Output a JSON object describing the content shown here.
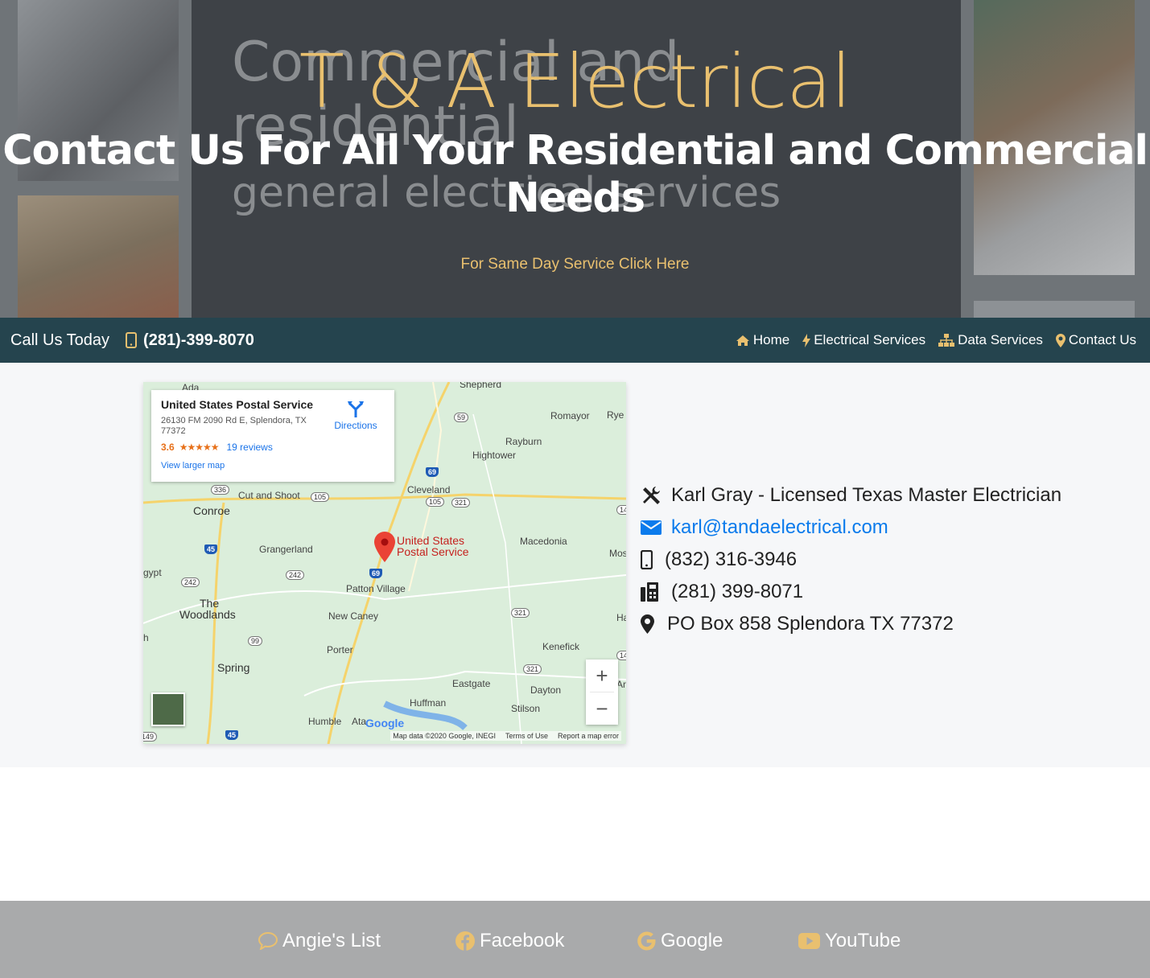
{
  "hero": {
    "bg_text_1": "Commercial and",
    "bg_text_2": "residential",
    "bg_text_3": "general electrical services",
    "title": "T & A Electrical",
    "subtitle": "Contact Us For All Your Residential and Commercial Needs",
    "cta": "For Same Day Service Click Here"
  },
  "nav": {
    "call_label": "Call Us Today",
    "phone": "(281)-399-8070",
    "links": [
      {
        "label": "Home",
        "icon": "home-icon"
      },
      {
        "label": "Electrical Services",
        "icon": "bolt-icon"
      },
      {
        "label": "Data Services",
        "icon": "network-icon"
      },
      {
        "label": "Contact Us",
        "icon": "map-marker-icon"
      }
    ]
  },
  "map": {
    "place_name": "United States Postal Service",
    "address": "26130 FM 2090 Rd E, Splendora, TX 77372",
    "rating": "3.6",
    "stars": "★★★★★",
    "reviews": "19 reviews",
    "larger_map": "View larger map",
    "directions": "Directions",
    "pin_label_1": "United States",
    "pin_label_2": "Postal Service",
    "zoom_in": "+",
    "zoom_out": "−",
    "google": "Google",
    "footer_data": "Map data ©2020 Google, INEGI",
    "footer_terms": "Terms of Use",
    "footer_report": "Report a map error",
    "labels": {
      "shepherd": "Shepherd",
      "romayor": "Romayor",
      "rye": "Rye",
      "rayburn": "Rayburn",
      "hightower": "Hightower",
      "cleveland": "Cleveland",
      "cut_and_shoot": "Cut and Shoot",
      "conroe": "Conroe",
      "grangerland": "Grangerland",
      "macedonia": "Macedonia",
      "mos": "Mos",
      "patton_village": "Patton Village",
      "gypt": "gypt",
      "the_woodlands_1": "The",
      "the_woodlands_2": "Woodlands",
      "new_caney": "New Caney",
      "ha": "Ha",
      "porter": "Porter",
      "kenefick": "Kenefick",
      "spring": "Spring",
      "eastgate": "Eastgate",
      "dayton": "Dayton",
      "huffman": "Huffman",
      "stilson": "Stilson",
      "humble": "Humble",
      "ata": "Ata",
      "an": "An",
      "h": "h",
      "ada": "Ada"
    },
    "shields": {
      "s336": "336",
      "s105a": "105",
      "s105b": "105",
      "s321a": "321",
      "s242a": "242",
      "s242b": "242",
      "s99": "99",
      "s321b": "321",
      "s321c": "321",
      "s59": "59",
      "s149": "149",
      "s14a": "14",
      "s14b": "14"
    },
    "interstates": {
      "i69a": "69",
      "i69b": "69",
      "i45a": "45",
      "i45b": "45"
    }
  },
  "contact": {
    "name": "Karl Gray - Licensed Texas Master Electrician",
    "email": "karl@tandaelectrical.com",
    "mobile": "(832) 316-3946",
    "fax": "(281) 399-8071",
    "address": "PO Box 858 Splendora TX 77372"
  },
  "footer": {
    "links": [
      {
        "label": "Angie's List",
        "icon": "comment-icon"
      },
      {
        "label": "Facebook",
        "icon": "facebook-icon"
      },
      {
        "label": "Google",
        "icon": "google-icon"
      },
      {
        "label": "YouTube",
        "icon": "youtube-icon"
      }
    ]
  },
  "colors": {
    "accent_gold": "#e9c06f",
    "nav_bg": "#25444e",
    "link_blue": "#0b7bec",
    "footer_bg": "#a9aaab"
  }
}
